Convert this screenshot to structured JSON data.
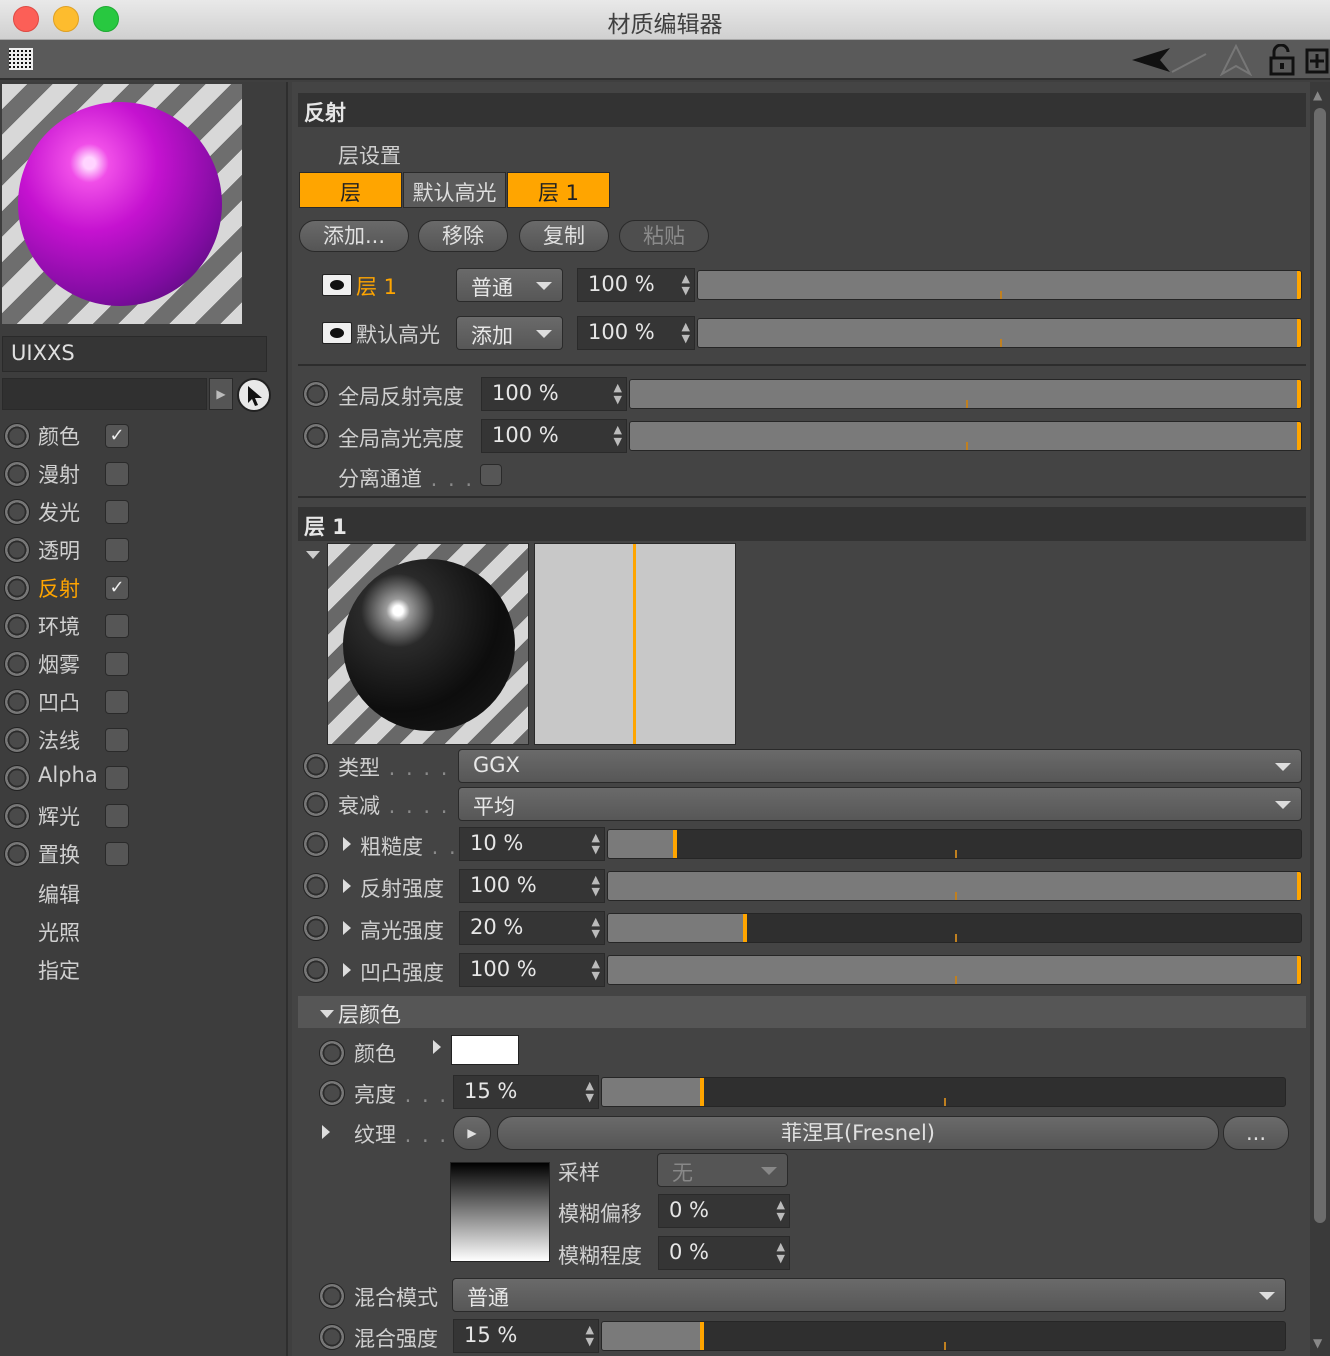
{
  "window": {
    "title": "材质编辑器"
  },
  "sidebar": {
    "material_name": "UIXXS",
    "channels": [
      {
        "label": "颜色",
        "checked": true,
        "active": false
      },
      {
        "label": "漫射",
        "checked": false,
        "active": false
      },
      {
        "label": "发光",
        "checked": false,
        "active": false
      },
      {
        "label": "透明",
        "checked": false,
        "active": false
      },
      {
        "label": "反射",
        "checked": true,
        "active": true
      },
      {
        "label": "环境",
        "checked": false,
        "active": false
      },
      {
        "label": "烟雾",
        "checked": false,
        "active": false
      },
      {
        "label": "凹凸",
        "checked": false,
        "active": false
      },
      {
        "label": "法线",
        "checked": false,
        "active": false
      },
      {
        "label": "Alpha",
        "checked": false,
        "active": false
      },
      {
        "label": "辉光",
        "checked": false,
        "active": false
      },
      {
        "label": "置换",
        "checked": false,
        "active": false
      }
    ],
    "extra": [
      "编辑",
      "光照",
      "指定"
    ],
    "check_mark": "✓"
  },
  "reflect": {
    "title": "反射",
    "layer_settings": "层设置",
    "tabs": [
      "层",
      "默认高光",
      "层 1"
    ],
    "buttons": {
      "add": "添加...",
      "remove": "移除",
      "copy": "复制",
      "paste": "粘贴"
    },
    "layers": [
      {
        "name": "层 1",
        "mode": "普通",
        "value": "100 %",
        "fraction": 1.0
      },
      {
        "name": "默认高光",
        "mode": "添加",
        "value": "100 %",
        "fraction": 1.0
      }
    ],
    "global_reflect": {
      "label": "全局反射亮度",
      "value": "100 %",
      "fraction": 1.0
    },
    "global_spec": {
      "label": "全局高光亮度",
      "value": "100 %",
      "fraction": 1.0
    },
    "separate_pass": "分离通道"
  },
  "layer1": {
    "title": "层 1",
    "type": {
      "label": "类型",
      "value": "GGX"
    },
    "attenuation": {
      "label": "衰减",
      "value": "平均"
    },
    "roughness": {
      "label": "粗糙度",
      "value": "10 %",
      "fraction": 0.1
    },
    "reflect_strength": {
      "label": "反射强度",
      "value": "100 %",
      "fraction": 1.0
    },
    "spec_strength": {
      "label": "高光强度",
      "value": "20 %",
      "fraction": 0.2
    },
    "bump_strength": {
      "label": "凹凸强度",
      "value": "100 %",
      "fraction": 1.0
    }
  },
  "layer_color": {
    "title": "层颜色",
    "color": {
      "label": "颜色",
      "hex": "#ffffff"
    },
    "brightness": {
      "label": "亮度",
      "value": "15 %",
      "fraction": 0.15
    },
    "texture": {
      "label": "纹理",
      "value": "菲涅耳(Fresnel)",
      "more": "..."
    },
    "sampling": {
      "label": "采样",
      "value": "无"
    },
    "blur_offset": {
      "label": "模糊偏移",
      "value": "0 %"
    },
    "blur_scale": {
      "label": "模糊程度",
      "value": "0 %"
    },
    "blend_mode": {
      "label": "混合模式",
      "value": "普通"
    },
    "blend_strength": {
      "label": "混合强度",
      "value": "15 %",
      "fraction": 0.15
    }
  },
  "colors": {
    "accent": "#ffa500",
    "panel": "#444444"
  }
}
